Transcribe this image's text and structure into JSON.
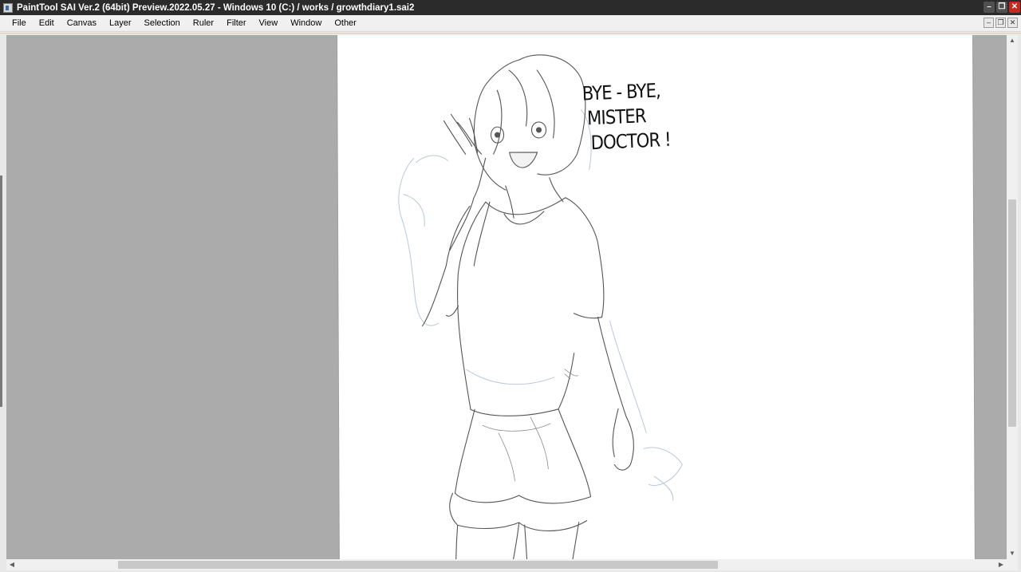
{
  "window": {
    "title": "PaintTool SAI Ver.2 (64bit) Preview.2022.05.27 - Windows 10 (C:) / works / growthdiary1.sai2",
    "minimize_glyph": "–",
    "maximize_glyph": "❐",
    "close_glyph": "✕"
  },
  "menu": {
    "items": [
      "File",
      "Edit",
      "Canvas",
      "Layer",
      "Selection",
      "Ruler",
      "Filter",
      "View",
      "Window",
      "Other"
    ]
  },
  "mdi": {
    "minimize_glyph": "–",
    "restore_glyph": "❐",
    "close_glyph": "✕"
  },
  "canvas": {
    "speech_text": [
      "BYE - BYE,",
      "MISTER",
      "DOCTOR !"
    ],
    "canvas_gray": "#ababab",
    "paper_color": "#ffffff"
  },
  "scrollbars": {
    "up_glyph": "▲",
    "down_glyph": "▼",
    "left_glyph": "◀",
    "right_glyph": "▶"
  },
  "colors": {
    "titlebar": "#2b2b2b",
    "close_button": "#c8281e",
    "menubar": "#f0f0f0"
  }
}
